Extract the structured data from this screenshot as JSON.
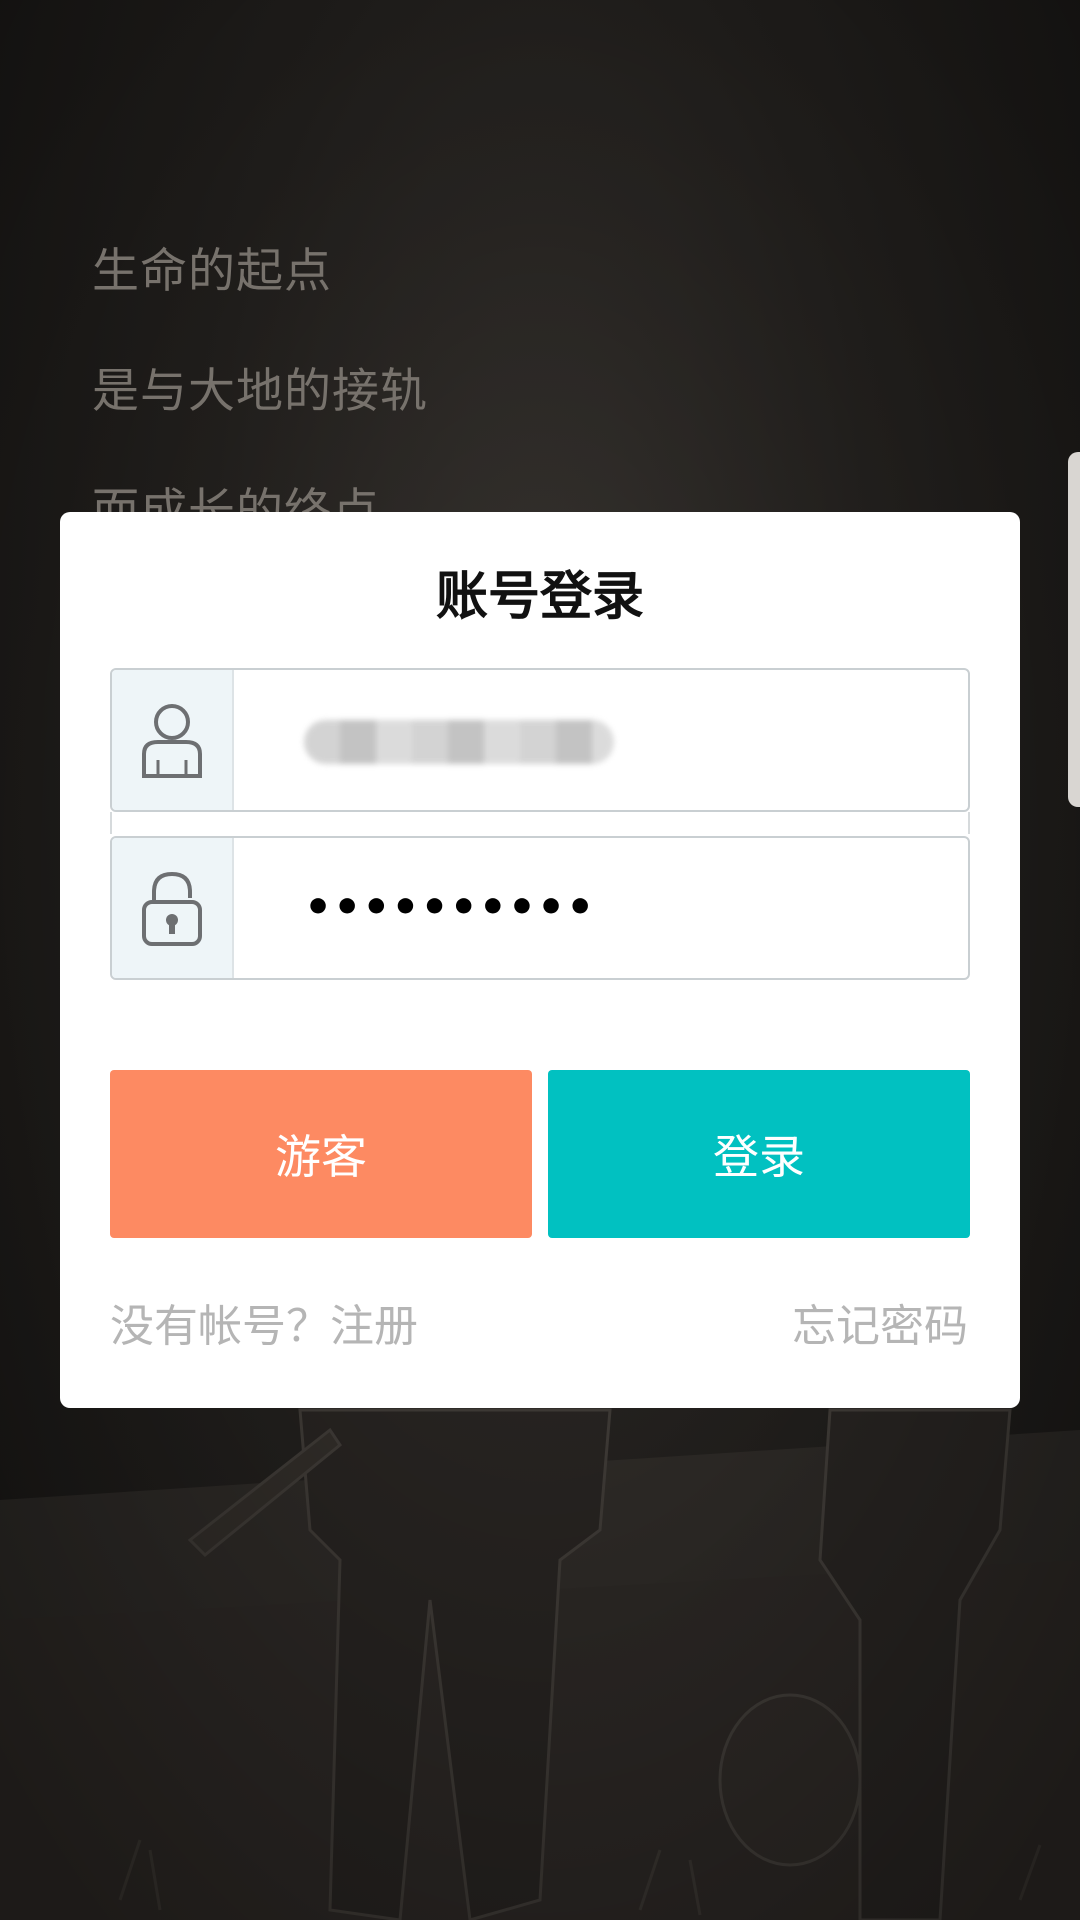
{
  "background": {
    "poem_lines": [
      "生命的起点",
      "是与大地的接轨",
      "而成长的终点"
    ]
  },
  "dialog": {
    "title": "账号登录",
    "username": {
      "icon": "user-icon",
      "value_obscured": true
    },
    "password": {
      "icon": "lock-icon",
      "value": "••••••••••"
    },
    "guest_button": "游客",
    "login_button": "登录",
    "register_link": "没有帐号？注册",
    "forgot_link": "忘记密码"
  },
  "colors": {
    "guest": "#fd8a62",
    "login": "#01c1c1",
    "link": "#b5b5b5"
  }
}
